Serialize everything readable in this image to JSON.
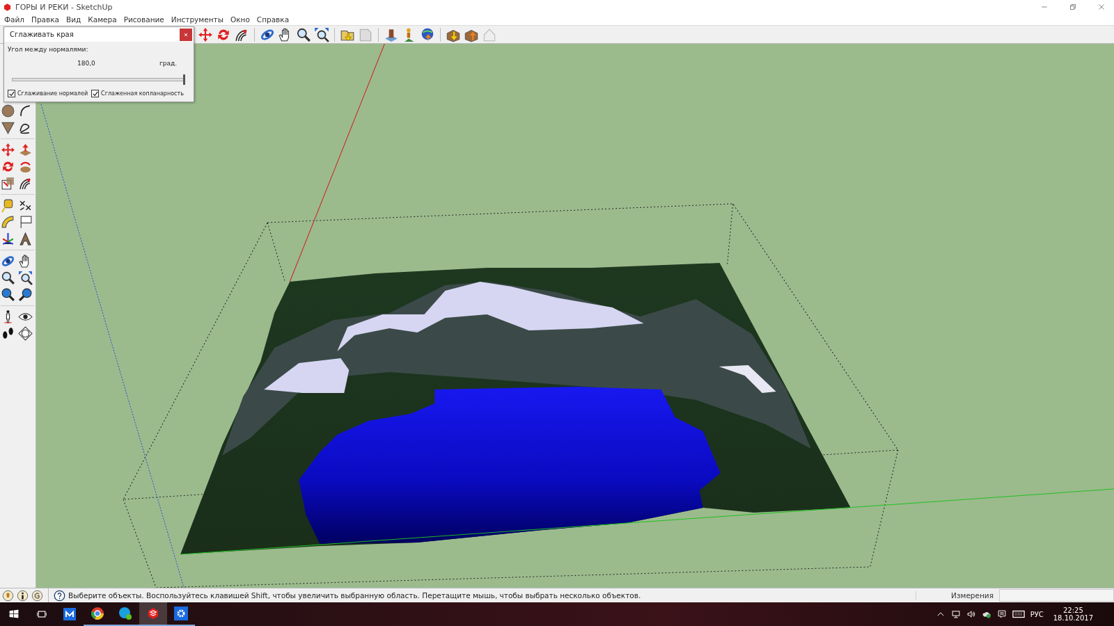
{
  "window": {
    "title": "ГОРЫ И РЕКИ - SketchUp"
  },
  "menu": [
    {
      "label": "Файл"
    },
    {
      "label": "Правка"
    },
    {
      "label": "Вид"
    },
    {
      "label": "Камера"
    },
    {
      "label": "Рисование"
    },
    {
      "label": "Инструменты"
    },
    {
      "label": "Окно"
    },
    {
      "label": "Справка"
    }
  ],
  "dialog": {
    "title": "Сглаживать края",
    "angle_label": "Угол между нормалями:",
    "angle_value": "180,0",
    "unit": "град.",
    "slider": {
      "level": 1.0
    },
    "checkboxes": [
      {
        "label": "Сглаживание нормалей",
        "checked": true
      },
      {
        "label": "Сглаженная копланарность",
        "checked": true
      }
    ]
  },
  "status_bar": {
    "message": "Выберите объекты. Воспользуйтесь клавишей Shift, чтобы увеличить выбранную область. Перетащите мышь, чтобы выбрать несколько объектов.",
    "measurements_label": "Измерения"
  },
  "taskbar": {
    "apps": [
      {
        "kind": "mail",
        "running": false,
        "selected": false
      },
      {
        "kind": "browser",
        "running": true,
        "selected": false
      },
      {
        "kind": "messenger",
        "running": true,
        "selected": false
      },
      {
        "kind": "modeler",
        "running": true,
        "selected": true
      },
      {
        "kind": "settings",
        "running": true,
        "selected": false
      }
    ],
    "language": "РУС",
    "time": "22:25",
    "date": "18.10.2017"
  }
}
